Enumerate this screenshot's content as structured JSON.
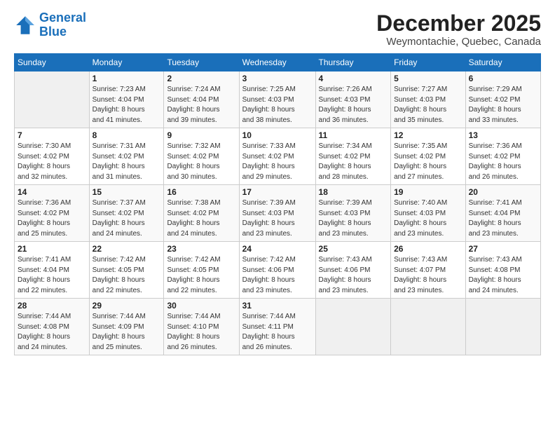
{
  "logo": {
    "line1": "General",
    "line2": "Blue"
  },
  "title": "December 2025",
  "location": "Weymontachie, Quebec, Canada",
  "headers": [
    "Sunday",
    "Monday",
    "Tuesday",
    "Wednesday",
    "Thursday",
    "Friday",
    "Saturday"
  ],
  "weeks": [
    [
      {
        "day": "",
        "info": ""
      },
      {
        "day": "1",
        "info": "Sunrise: 7:23 AM\nSunset: 4:04 PM\nDaylight: 8 hours\nand 41 minutes."
      },
      {
        "day": "2",
        "info": "Sunrise: 7:24 AM\nSunset: 4:04 PM\nDaylight: 8 hours\nand 39 minutes."
      },
      {
        "day": "3",
        "info": "Sunrise: 7:25 AM\nSunset: 4:03 PM\nDaylight: 8 hours\nand 38 minutes."
      },
      {
        "day": "4",
        "info": "Sunrise: 7:26 AM\nSunset: 4:03 PM\nDaylight: 8 hours\nand 36 minutes."
      },
      {
        "day": "5",
        "info": "Sunrise: 7:27 AM\nSunset: 4:03 PM\nDaylight: 8 hours\nand 35 minutes."
      },
      {
        "day": "6",
        "info": "Sunrise: 7:29 AM\nSunset: 4:02 PM\nDaylight: 8 hours\nand 33 minutes."
      }
    ],
    [
      {
        "day": "7",
        "info": "Sunrise: 7:30 AM\nSunset: 4:02 PM\nDaylight: 8 hours\nand 32 minutes."
      },
      {
        "day": "8",
        "info": "Sunrise: 7:31 AM\nSunset: 4:02 PM\nDaylight: 8 hours\nand 31 minutes."
      },
      {
        "day": "9",
        "info": "Sunrise: 7:32 AM\nSunset: 4:02 PM\nDaylight: 8 hours\nand 30 minutes."
      },
      {
        "day": "10",
        "info": "Sunrise: 7:33 AM\nSunset: 4:02 PM\nDaylight: 8 hours\nand 29 minutes."
      },
      {
        "day": "11",
        "info": "Sunrise: 7:34 AM\nSunset: 4:02 PM\nDaylight: 8 hours\nand 28 minutes."
      },
      {
        "day": "12",
        "info": "Sunrise: 7:35 AM\nSunset: 4:02 PM\nDaylight: 8 hours\nand 27 minutes."
      },
      {
        "day": "13",
        "info": "Sunrise: 7:36 AM\nSunset: 4:02 PM\nDaylight: 8 hours\nand 26 minutes."
      }
    ],
    [
      {
        "day": "14",
        "info": "Sunrise: 7:36 AM\nSunset: 4:02 PM\nDaylight: 8 hours\nand 25 minutes."
      },
      {
        "day": "15",
        "info": "Sunrise: 7:37 AM\nSunset: 4:02 PM\nDaylight: 8 hours\nand 24 minutes."
      },
      {
        "day": "16",
        "info": "Sunrise: 7:38 AM\nSunset: 4:02 PM\nDaylight: 8 hours\nand 24 minutes."
      },
      {
        "day": "17",
        "info": "Sunrise: 7:39 AM\nSunset: 4:03 PM\nDaylight: 8 hours\nand 23 minutes."
      },
      {
        "day": "18",
        "info": "Sunrise: 7:39 AM\nSunset: 4:03 PM\nDaylight: 8 hours\nand 23 minutes."
      },
      {
        "day": "19",
        "info": "Sunrise: 7:40 AM\nSunset: 4:03 PM\nDaylight: 8 hours\nand 23 minutes."
      },
      {
        "day": "20",
        "info": "Sunrise: 7:41 AM\nSunset: 4:04 PM\nDaylight: 8 hours\nand 23 minutes."
      }
    ],
    [
      {
        "day": "21",
        "info": "Sunrise: 7:41 AM\nSunset: 4:04 PM\nDaylight: 8 hours\nand 22 minutes."
      },
      {
        "day": "22",
        "info": "Sunrise: 7:42 AM\nSunset: 4:05 PM\nDaylight: 8 hours\nand 22 minutes."
      },
      {
        "day": "23",
        "info": "Sunrise: 7:42 AM\nSunset: 4:05 PM\nDaylight: 8 hours\nand 22 minutes."
      },
      {
        "day": "24",
        "info": "Sunrise: 7:42 AM\nSunset: 4:06 PM\nDaylight: 8 hours\nand 23 minutes."
      },
      {
        "day": "25",
        "info": "Sunrise: 7:43 AM\nSunset: 4:06 PM\nDaylight: 8 hours\nand 23 minutes."
      },
      {
        "day": "26",
        "info": "Sunrise: 7:43 AM\nSunset: 4:07 PM\nDaylight: 8 hours\nand 23 minutes."
      },
      {
        "day": "27",
        "info": "Sunrise: 7:43 AM\nSunset: 4:08 PM\nDaylight: 8 hours\nand 24 minutes."
      }
    ],
    [
      {
        "day": "28",
        "info": "Sunrise: 7:44 AM\nSunset: 4:08 PM\nDaylight: 8 hours\nand 24 minutes."
      },
      {
        "day": "29",
        "info": "Sunrise: 7:44 AM\nSunset: 4:09 PM\nDaylight: 8 hours\nand 25 minutes."
      },
      {
        "day": "30",
        "info": "Sunrise: 7:44 AM\nSunset: 4:10 PM\nDaylight: 8 hours\nand 26 minutes."
      },
      {
        "day": "31",
        "info": "Sunrise: 7:44 AM\nSunset: 4:11 PM\nDaylight: 8 hours\nand 26 minutes."
      },
      {
        "day": "",
        "info": ""
      },
      {
        "day": "",
        "info": ""
      },
      {
        "day": "",
        "info": ""
      }
    ]
  ]
}
